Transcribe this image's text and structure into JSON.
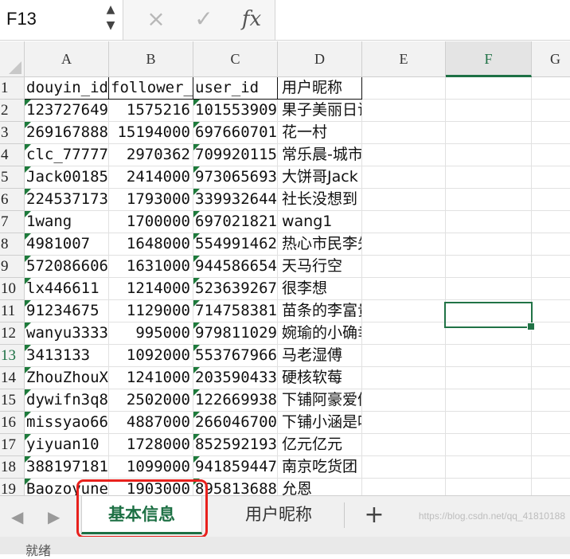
{
  "formula_bar": {
    "name_box": "F13",
    "cancel_icon": "×",
    "confirm_icon": "✓",
    "fx_icon": "fx",
    "formula": ""
  },
  "columns": [
    "A",
    "B",
    "C",
    "D",
    "E",
    "F",
    "G"
  ],
  "rows": [
    {
      "num": "1",
      "a": "douyin_id",
      "b": "follower_num",
      "c": "user_id",
      "d": "用户昵称"
    },
    {
      "num": "2",
      "a": "123727649",
      "b": "1575216",
      "c": "101553909",
      "d": "果子美丽日记"
    },
    {
      "num": "3",
      "a": "269167888",
      "b": "15194000",
      "c": "697660701",
      "d": "花一村"
    },
    {
      "num": "4",
      "a": "clc_77777",
      "b": "2970362",
      "c": "709920115",
      "d": "常乐晨-城市传奇"
    },
    {
      "num": "5",
      "a": "Jack00185",
      "b": "2414000",
      "c": "973065693",
      "d": "大饼哥Jack"
    },
    {
      "num": "6",
      "a": "224537173",
      "b": "1793000",
      "c": "339932644",
      "d": "社长没想到"
    },
    {
      "num": "7",
      "a": "1wang",
      "b": "1700000",
      "c": "697021821",
      "d": "wang1"
    },
    {
      "num": "8",
      "a": "4981007",
      "b": "1648000",
      "c": "554991462",
      "d": "热心市民李先生"
    },
    {
      "num": "9",
      "a": "572086606",
      "b": "1631000",
      "c": "944586654",
      "d": "天马行空"
    },
    {
      "num": "10",
      "a": "lx446611",
      "b": "1214000",
      "c": "523639267",
      "d": "很李想"
    },
    {
      "num": "11",
      "a": "91234675",
      "b": "1129000",
      "c": "714758381",
      "d": "苗条的李富贵"
    },
    {
      "num": "12",
      "a": "wanyu3333",
      "b": "995000",
      "c": "979811029",
      "d": "婉瑜的小确幸"
    },
    {
      "num": "13",
      "a": "3413133",
      "b": "1092000",
      "c": "553767966",
      "d": "马老湿傅"
    },
    {
      "num": "14",
      "a": "ZhouZhouX",
      "b": "1241000",
      "c": "203590433",
      "d": "硬核软莓"
    },
    {
      "num": "15",
      "a": "dywifn3q8",
      "b": "2502000",
      "c": "122669938",
      "d": "下铺阿豪爱偷吃"
    },
    {
      "num": "16",
      "a": "missyao66",
      "b": "4887000",
      "c": "266046700",
      "d": "下铺小涵是吃货"
    },
    {
      "num": "17",
      "a": "yiyuan10",
      "b": "1728000",
      "c": "852592193",
      "d": "亿元亿元"
    },
    {
      "num": "18",
      "a": "388197181",
      "b": "1099000",
      "c": "941859447",
      "d": "南京吃货团"
    },
    {
      "num": "19",
      "a": "Baozoyune",
      "b": "1903000",
      "c": "895813688",
      "d": "允恩"
    }
  ],
  "active_cell": {
    "column": "F",
    "row": "13"
  },
  "sheet_tabs": [
    {
      "label": "基本信息",
      "active": true
    },
    {
      "label": "用户昵称",
      "active": false
    }
  ],
  "add_sheet_icon": "+",
  "watermark": "https://blog.csdn.net/qq_41810188",
  "status": "就绪"
}
